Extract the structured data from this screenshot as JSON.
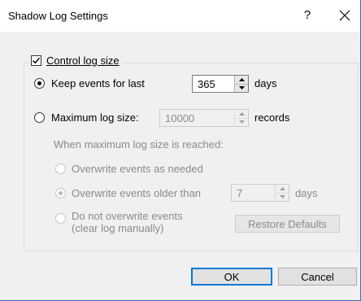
{
  "window": {
    "title": "Shadow Log Settings",
    "help_glyph": "?",
    "close_glyph": "✕"
  },
  "control_log_size": {
    "label": "Control log size",
    "checked": true
  },
  "keep_events": {
    "label": "Keep events for last",
    "selected": true,
    "value": "365",
    "unit": "days"
  },
  "max_log_size": {
    "label": "Maximum log size:",
    "selected": false,
    "value": "10000",
    "unit": "records"
  },
  "when_reached_label": "When maximum log size is reached:",
  "overwrite_needed": {
    "label": "Overwrite events as needed"
  },
  "overwrite_older": {
    "label": "Overwrite events older than",
    "value": "7",
    "unit": "days",
    "selected": true
  },
  "do_not_overwrite": {
    "line1": "Do not overwrite events",
    "line2": "(clear log manually)"
  },
  "buttons": {
    "restore_defaults": "Restore Defaults",
    "ok": "OK",
    "cancel": "Cancel"
  },
  "colors": {
    "accent": "#0078d7",
    "disabled_text": "#8a8a8a"
  }
}
